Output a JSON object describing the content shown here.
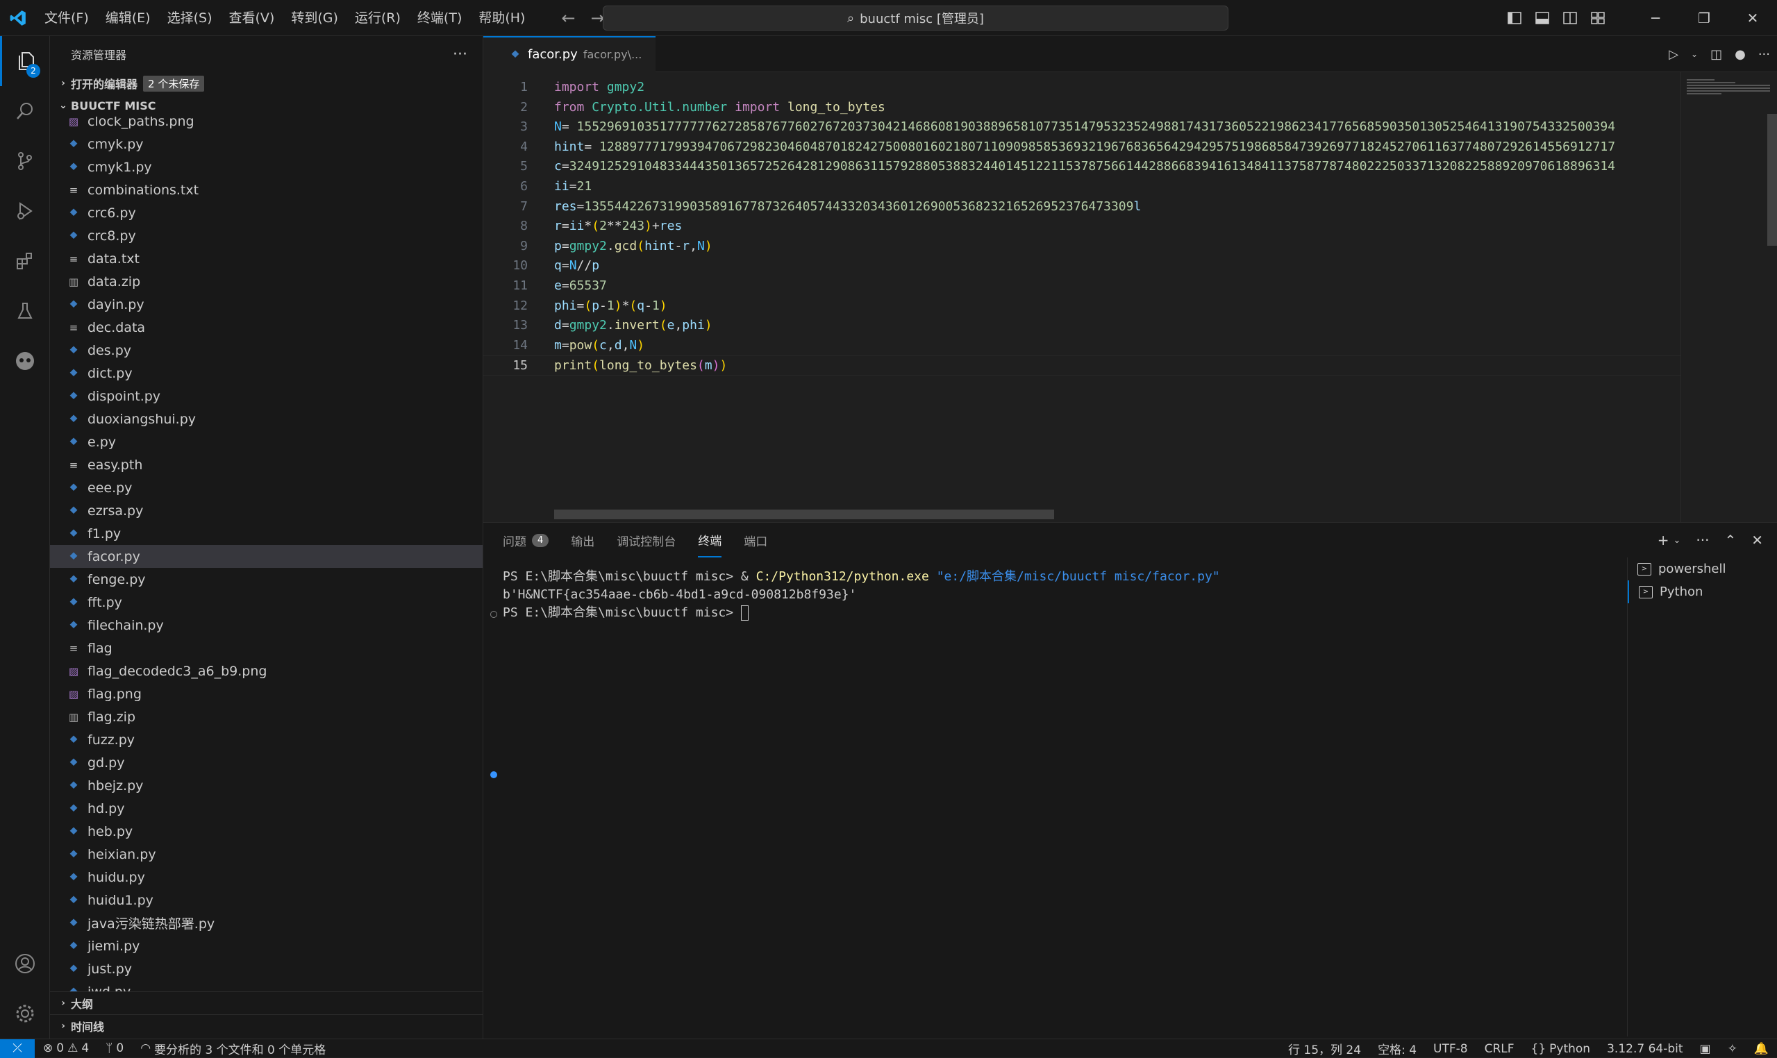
{
  "titlebar": {
    "menus": [
      "文件(F)",
      "编辑(E)",
      "选择(S)",
      "查看(V)",
      "转到(G)",
      "运行(R)",
      "终端(T)",
      "帮助(H)"
    ],
    "search_text": "buuctf misc [管理员]"
  },
  "activity": {
    "explorer_badge": "2"
  },
  "sidebar": {
    "title": "资源管理器",
    "open_editors_label": "打开的编辑器",
    "unsaved_label": "2 个未保存",
    "folder_label": "BUUCTF MISC",
    "files": [
      {
        "name": "clock_paths.png",
        "type": "img"
      },
      {
        "name": "cmyk.py",
        "type": "py"
      },
      {
        "name": "cmyk1.py",
        "type": "py"
      },
      {
        "name": "combinations.txt",
        "type": "txt"
      },
      {
        "name": "crc6.py",
        "type": "py"
      },
      {
        "name": "crc8.py",
        "type": "py"
      },
      {
        "name": "data.txt",
        "type": "txt"
      },
      {
        "name": "data.zip",
        "type": "zip"
      },
      {
        "name": "dayin.py",
        "type": "py"
      },
      {
        "name": "dec.data",
        "type": "txt"
      },
      {
        "name": "des.py",
        "type": "py"
      },
      {
        "name": "dict.py",
        "type": "py"
      },
      {
        "name": "dispoint.py",
        "type": "py"
      },
      {
        "name": "duoxiangshui.py",
        "type": "py"
      },
      {
        "name": "e.py",
        "type": "py"
      },
      {
        "name": "easy.pth",
        "type": "txt"
      },
      {
        "name": "eee.py",
        "type": "py"
      },
      {
        "name": "ezrsa.py",
        "type": "py"
      },
      {
        "name": "f1.py",
        "type": "py"
      },
      {
        "name": "facor.py",
        "type": "py",
        "selected": true
      },
      {
        "name": "fenge.py",
        "type": "py"
      },
      {
        "name": "fft.py",
        "type": "py"
      },
      {
        "name": "filechain.py",
        "type": "py"
      },
      {
        "name": "flag",
        "type": "plain"
      },
      {
        "name": "flag_decodedc3_a6_b9.png",
        "type": "img"
      },
      {
        "name": "flag.png",
        "type": "img"
      },
      {
        "name": "flag.zip",
        "type": "zip"
      },
      {
        "name": "fuzz.py",
        "type": "py"
      },
      {
        "name": "gd.py",
        "type": "py"
      },
      {
        "name": "hbejz.py",
        "type": "py"
      },
      {
        "name": "hd.py",
        "type": "py"
      },
      {
        "name": "heb.py",
        "type": "py"
      },
      {
        "name": "heixian.py",
        "type": "py"
      },
      {
        "name": "huidu.py",
        "type": "py"
      },
      {
        "name": "huidu1.py",
        "type": "py"
      },
      {
        "name": "java污染链热部署.py",
        "type": "py"
      },
      {
        "name": "jiemi.py",
        "type": "py"
      },
      {
        "name": "just.py",
        "type": "py"
      },
      {
        "name": "jwd.py",
        "type": "py"
      }
    ],
    "outline_label": "大纲",
    "timeline_label": "时间线"
  },
  "editor": {
    "tab_name": "facor.py",
    "tab_desc": "facor.py\\...",
    "lines": [
      "import gmpy2",
      "from Crypto.Util.number import long_to_bytes",
      "N= 155296910351777777627285876776027672037304214686081903889658107735147953235249881743173605221986234177656859035013052546413190754332500394",
      "hint= 128897771799394706729823046048701824275008016021807110909858536932196768365642942957519868584739269771824527061163774807292614556912717",
      "c=3249125291048334443501365725264281290863115792880538832440145122115378756614428866839416134841137587787480222503371320822588920970618896314",
      "ii=21",
      "res=1355442267319903589167787326405744332034360126900536823216526952376473309l",
      "r=ii*(2**243)+res",
      "p=gmpy2.gcd(hint-r,N)",
      "q=N//p",
      "e=65537",
      "phi=(p-1)*(q-1)",
      "d=gmpy2.invert(e,phi)",
      "m=pow(c,d,N)",
      "print(long_to_bytes(m))"
    ]
  },
  "panel": {
    "tabs": [
      {
        "label": "问题",
        "count": "4"
      },
      {
        "label": "输出"
      },
      {
        "label": "调试控制台"
      },
      {
        "label": "终端",
        "active": true
      },
      {
        "label": "端口"
      }
    ],
    "terminal": {
      "line1_prompt": "PS E:\\脚本合集\\misc\\buuctf misc> & ",
      "line1_exe": "C:/Python312/python.exe",
      "line1_arg": " \"e:/脚本合集/misc/buuctf misc/facor.py\"",
      "line2": "b'H&NCTF{ac354aae-cb6b-4bd1-a9cd-090812b8f93e}'",
      "line3_prompt": "PS E:\\脚本合集\\misc\\buuctf misc> "
    },
    "terminal_list": [
      "powershell",
      "Python"
    ]
  },
  "statusbar": {
    "errors": "0",
    "warnings": "4",
    "ports": "0",
    "analysis": "要分析的 3 个文件和 0 个单元格",
    "position": "行 15，列 24",
    "spaces": "空格: 4",
    "encoding": "UTF-8",
    "eol": "CRLF",
    "language": "Python",
    "interpreter": "3.12.7 64-bit"
  },
  "colors": {
    "accent": "#0078d4",
    "background": "#1f1f1f",
    "sidebar": "#181818"
  }
}
